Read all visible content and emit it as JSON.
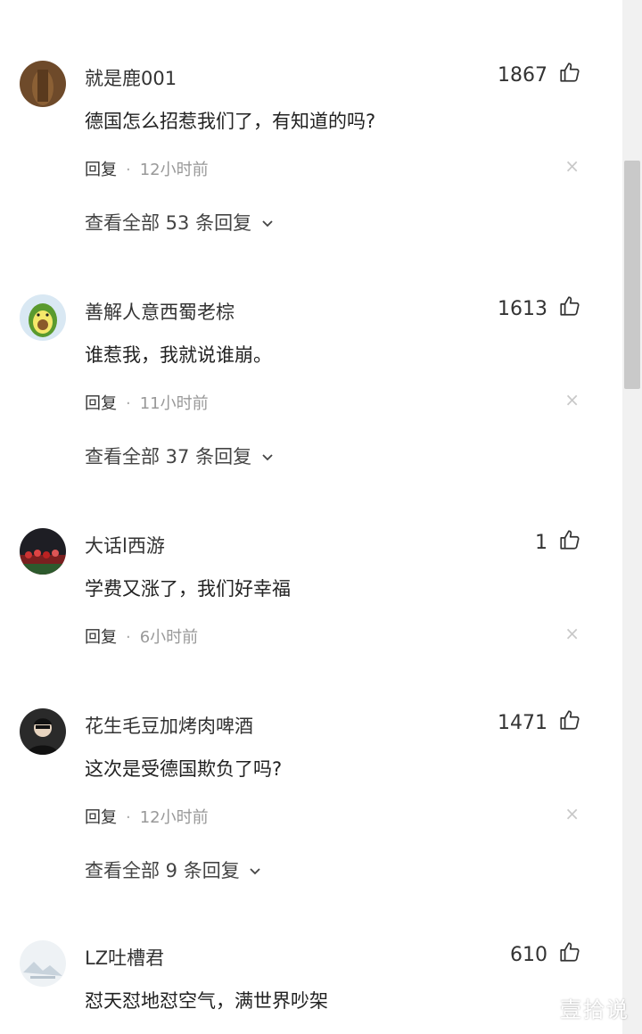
{
  "comments": [
    {
      "username": "就是鹿001",
      "likes": "1867",
      "text": "德国怎么招惹我们了，有知道的吗?",
      "reply_label": "回复",
      "time": "12小时前",
      "view_replies": "查看全部 53 条回复"
    },
    {
      "username": "善解人意西蜀老棕",
      "likes": "1613",
      "text": "谁惹我，我就说谁崩。",
      "reply_label": "回复",
      "time": "11小时前",
      "view_replies": "查看全部 37 条回复"
    },
    {
      "username": "大话l西游",
      "likes": "1",
      "text": "学费又涨了，我们好幸福",
      "reply_label": "回复",
      "time": "6小时前"
    },
    {
      "username": "花生毛豆加烤肉啤酒",
      "likes": "1471",
      "text": "这次是受德国欺负了吗?",
      "reply_label": "回复",
      "time": "12小时前",
      "view_replies": "查看全部 9 条回复"
    },
    {
      "username": "LZ吐槽君",
      "likes": "610",
      "text": "怼天怼地怼空气，满世界吵架"
    }
  ],
  "separator": "·",
  "watermark": "壹拾说",
  "icons": {
    "like": "thumbs-up-icon",
    "close": "close-icon",
    "expand": "chevron-down-icon"
  },
  "colors": {
    "text": "#222222",
    "muted": "#999999",
    "close": "#c8c8c8"
  }
}
